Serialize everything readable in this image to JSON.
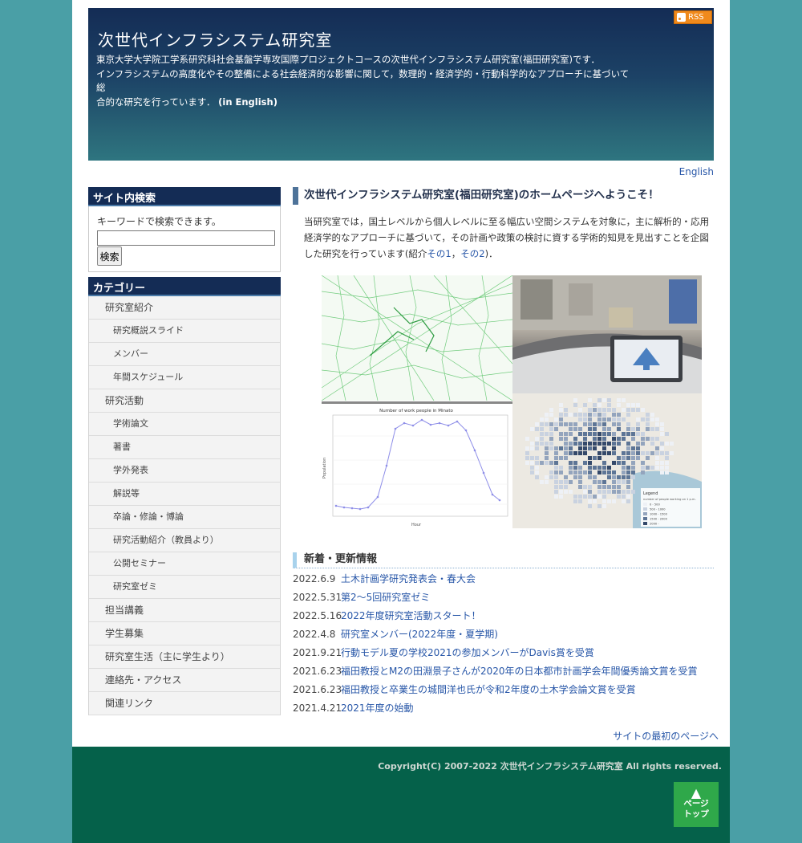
{
  "header": {
    "rss_label": "RSS",
    "title": "次世代インフラシステム研究室",
    "desc_line1": "東京大学大学院工学系研究科社会基盤学専攻国際プロジェクトコースの次世代インフラシステム研究室(福田研究室)です．",
    "desc_line2": "インフラシステムの高度化やその整備による社会経済的な影響に関して，数理的・経済学的・行動科学的なアプローチに基づいて総",
    "desc_line3": "合的な研究を行っています．",
    "in_english": "(in English)"
  },
  "lang_link": "English",
  "search": {
    "title": "サイト内検索",
    "hint": "キーワードで検索できます。",
    "placeholder": "",
    "button": "検索"
  },
  "categories": {
    "title": "カテゴリー",
    "items": [
      {
        "label": "研究室紹介",
        "level": 1
      },
      {
        "label": "研究概説スライド",
        "level": 2
      },
      {
        "label": "メンバー",
        "level": 2
      },
      {
        "label": "年間スケジュール",
        "level": 2
      },
      {
        "label": "研究活動",
        "level": 1
      },
      {
        "label": "学術論文",
        "level": 2
      },
      {
        "label": "著書",
        "level": 2
      },
      {
        "label": "学外発表",
        "level": 2
      },
      {
        "label": "解説等",
        "level": 2
      },
      {
        "label": "卒論・修論・博論",
        "level": 2
      },
      {
        "label": "研究活動紹介（教員より）",
        "level": 2
      },
      {
        "label": "公開セミナー",
        "level": 2
      },
      {
        "label": "研究室ゼミ",
        "level": 2
      },
      {
        "label": "担当講義",
        "level": 1
      },
      {
        "label": "学生募集",
        "level": 1
      },
      {
        "label": "研究室生活（主に学生より）",
        "level": 1
      },
      {
        "label": "連絡先・アクセス",
        "level": 1
      },
      {
        "label": "関連リンク",
        "level": 1
      }
    ]
  },
  "main": {
    "welcome_title": "次世代インフラシステム研究室(福田研究室)のホームページへようこそ！",
    "intro_1": "当研究室では，国土レベルから個人レベルに至る幅広い空間システムを対象に，主に解析的・応用経済学的なアプローチに基づいて，その計画や政策の検討に資する学術的知見を見出すことを企図した研究を行っています(紹介",
    "intro_link1": "その1",
    "intro_sep": "，",
    "intro_link2": "その2",
    "intro_end": ")．",
    "chart_title": "Number of work people in Minato",
    "chart_xlabel": "Hour",
    "chart_ylabel": "Population",
    "legend_title": "Legend",
    "legend_sub": "number of people working on 1 p.m.",
    "legend_items": [
      "0 - 500",
      "500 - 1000",
      "1000 - 1500",
      "1500 - 2000",
      "2000 -"
    ]
  },
  "news": {
    "title": "新着・更新情報",
    "items": [
      {
        "date": "2022.6.9",
        "title": "土木計画学研究発表会・春大会"
      },
      {
        "date": "2022.5.31",
        "title": "第2〜5回研究室ゼミ"
      },
      {
        "date": "2022.5.16",
        "title": "2022年度研究室活動スタート！"
      },
      {
        "date": "2022.4.8",
        "title": "研究室メンバー(2022年度・夏学期)"
      },
      {
        "date": "2021.9.21",
        "title": "行動モデル夏の学校2021の参加メンバーがDavis賞を受賞"
      },
      {
        "date": "2021.6.23",
        "title": "福田教授とM2の田淵景子さんが2020年の日本都市計画学会年間優秀論文賞を受賞"
      },
      {
        "date": "2021.6.23",
        "title": "福田教授と卒業生の城間洋也氏が令和2年度の土木学会論文賞を受賞"
      },
      {
        "date": "2021.4.21",
        "title": "2021年度の始動"
      }
    ]
  },
  "to_top_link": "サイトの最初のページへ",
  "footer": {
    "copyright": "Copyright(C) 2007-2022 次世代インフラシステム研究室 All rights reserved.",
    "pagetop_line1": "ページ",
    "pagetop_line2": "トップ"
  }
}
